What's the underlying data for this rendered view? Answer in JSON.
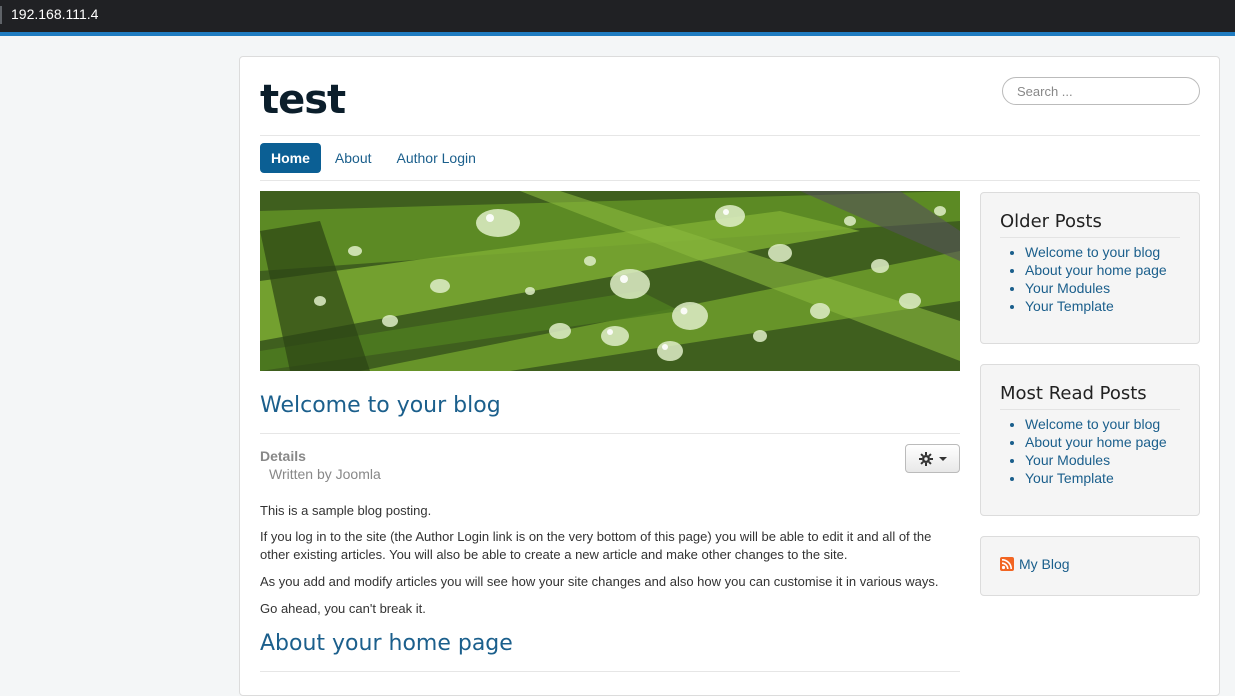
{
  "browser": {
    "address": "192.168.111.4"
  },
  "site": {
    "title": "test"
  },
  "search": {
    "placeholder": "Search ..."
  },
  "nav": {
    "items": [
      "Home",
      "About",
      "Author Login"
    ]
  },
  "article1": {
    "title": "Welcome to your blog",
    "details_label": "Details",
    "written_by": "Written by Joomla",
    "paragraphs": [
      "This is a sample blog posting.",
      "If you log in to the site (the Author Login link is on the very bottom of this page) you will be able to edit it and all of the other existing articles. You will also be able to create a new article and make other changes to the site.",
      "As you add and modify articles you will see how your site changes and also how you can customise it in various ways.",
      "Go ahead, you can't break it."
    ]
  },
  "article2": {
    "title": "About your home page"
  },
  "sidebar": {
    "older_posts": {
      "title": "Older Posts",
      "items": [
        "Welcome to your blog",
        "About your home page",
        "Your Modules",
        "Your Template"
      ]
    },
    "most_read": {
      "title": "Most Read Posts",
      "items": [
        "Welcome to your blog",
        "About your home page",
        "Your Modules",
        "Your Template"
      ]
    },
    "feed": {
      "label": "My Blog"
    }
  },
  "colors": {
    "accent": "#0b5f94",
    "link": "#1b5f8c",
    "rss": "#f26522"
  }
}
